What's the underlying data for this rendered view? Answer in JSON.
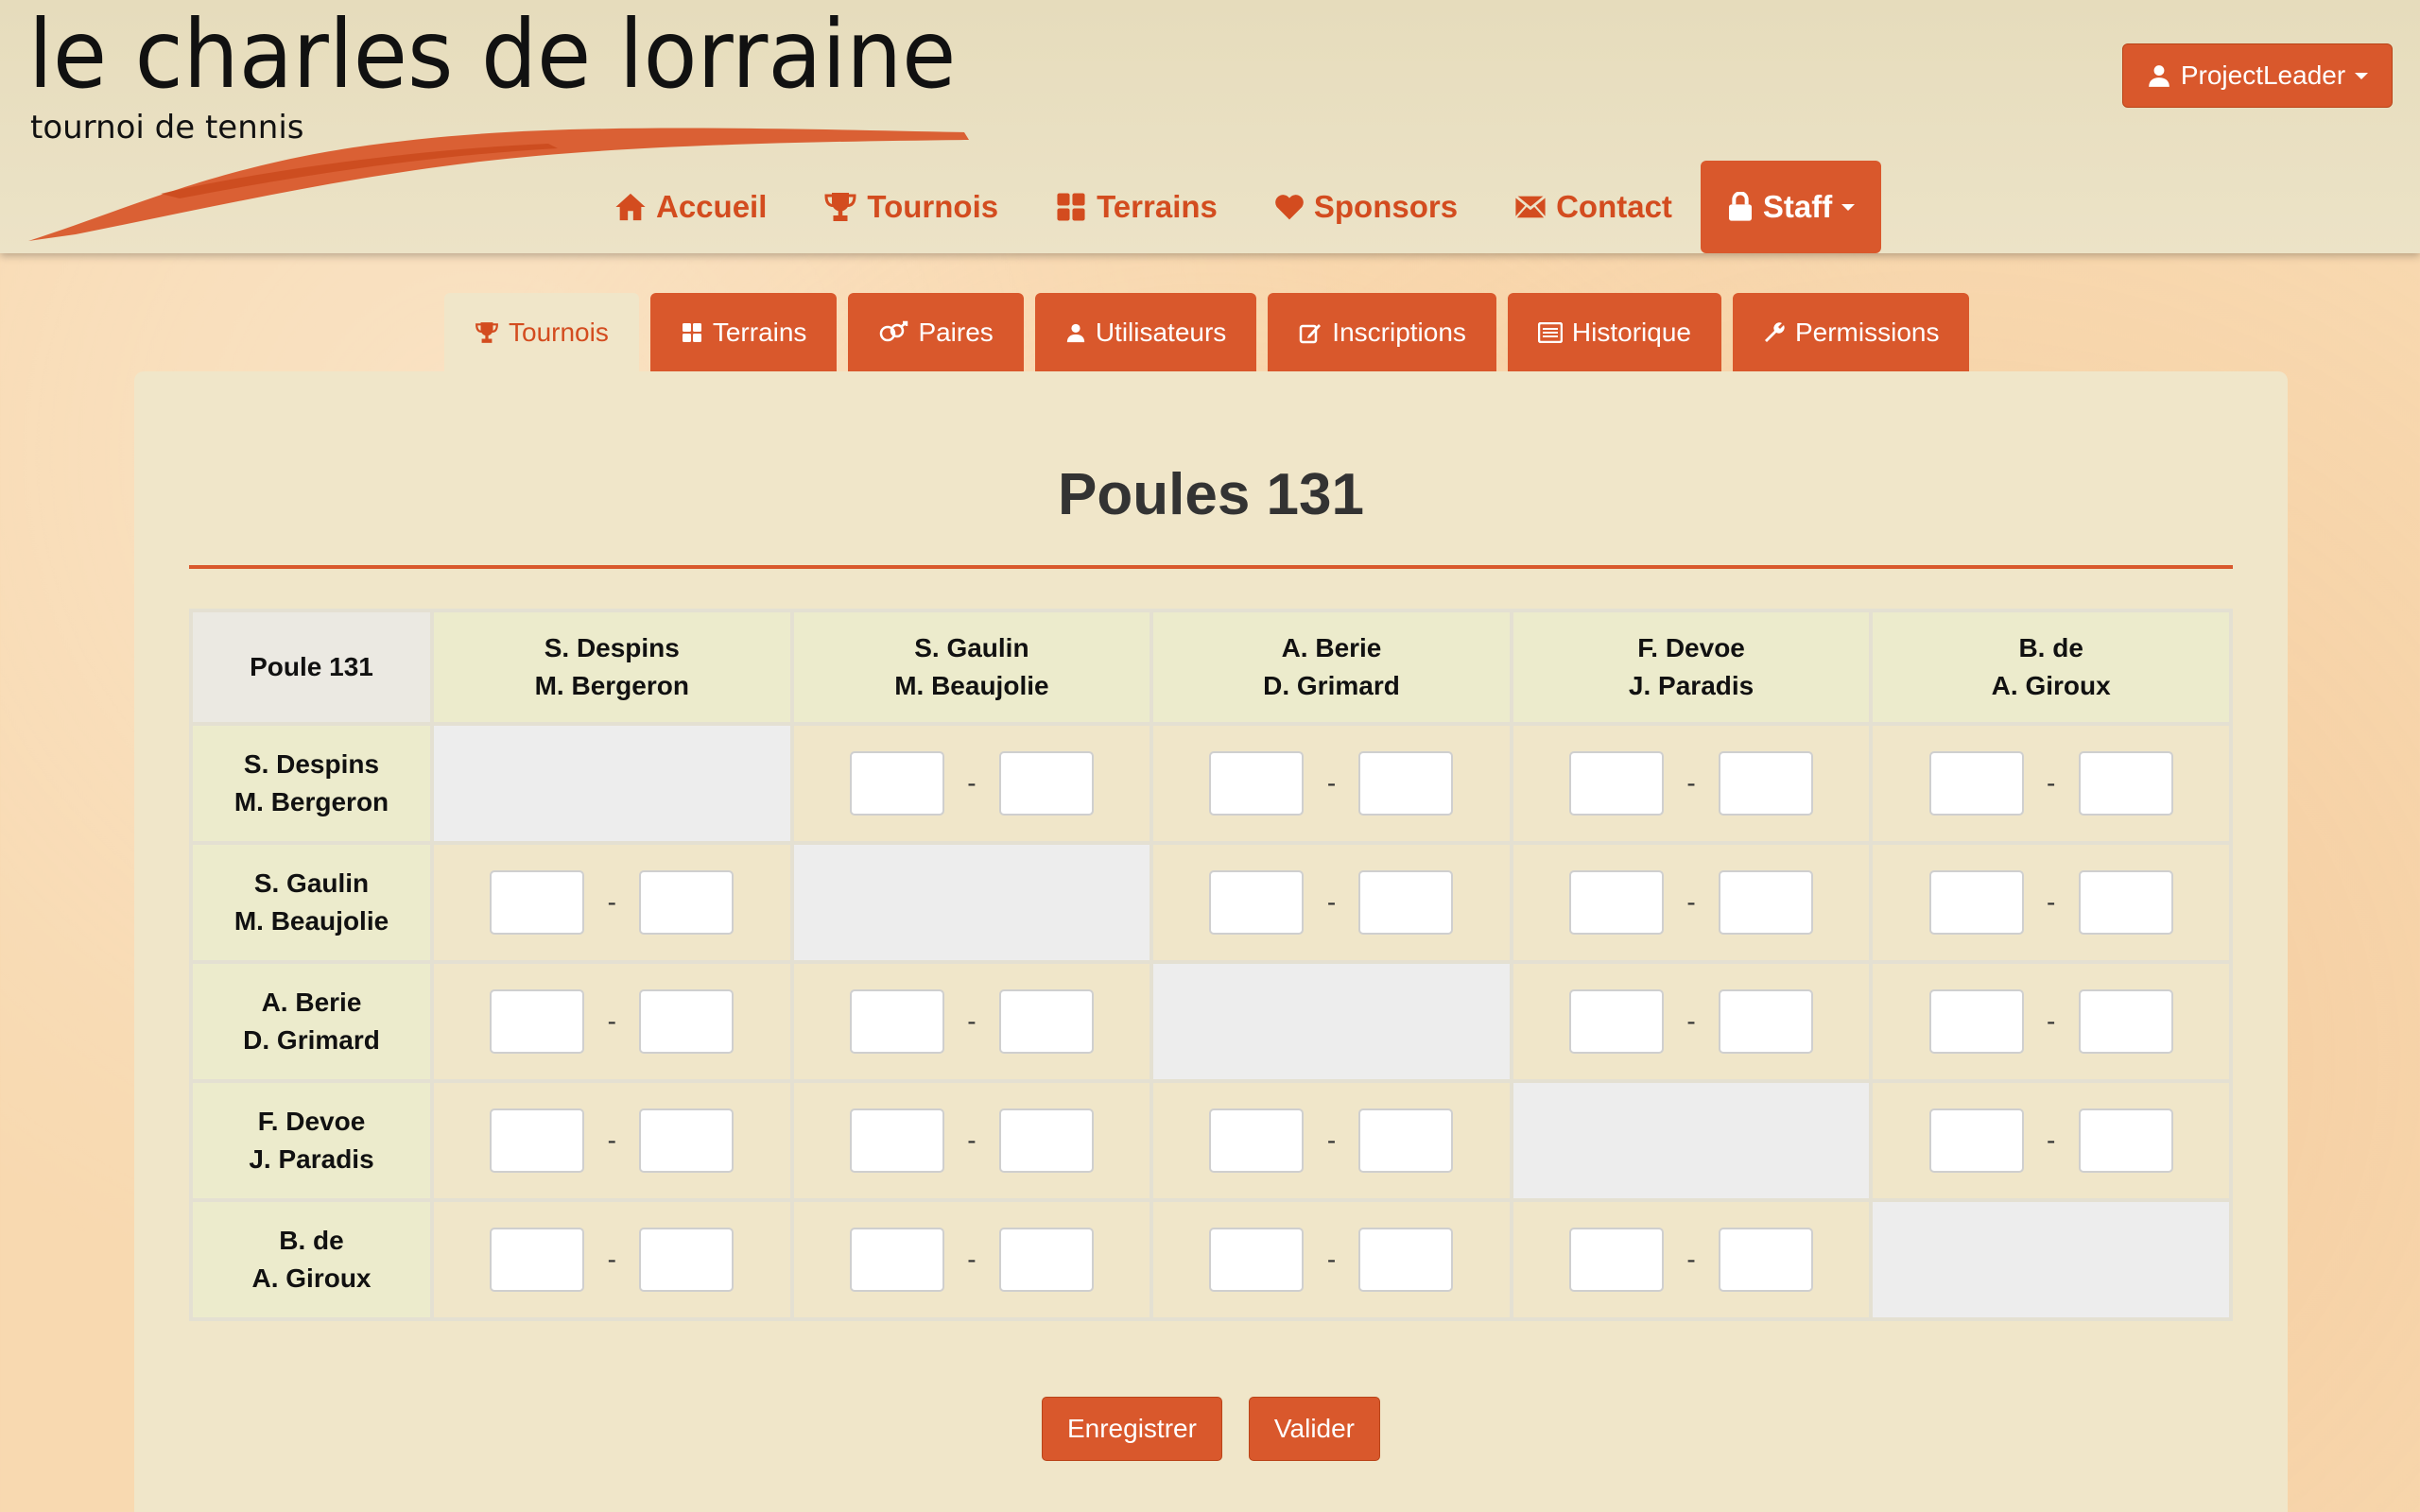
{
  "brand": {
    "title": "le charles de lorraine",
    "subtitle": "tournoi de tennis",
    "accent": "#d9582c"
  },
  "user_menu": {
    "label": "ProjectLeader",
    "icon": "user-icon"
  },
  "nav": [
    {
      "label": "Accueil",
      "icon": "home-icon"
    },
    {
      "label": "Tournois",
      "icon": "trophy-icon"
    },
    {
      "label": "Terrains",
      "icon": "grid-icon"
    },
    {
      "label": "Sponsors",
      "icon": "heart-icon"
    },
    {
      "label": "Contact",
      "icon": "envelope-icon"
    },
    {
      "label": "Staff",
      "icon": "lock-icon",
      "active": true
    }
  ],
  "tabs": [
    {
      "label": "Tournois",
      "icon": "trophy-icon",
      "active": true
    },
    {
      "label": "Terrains",
      "icon": "grid-icon"
    },
    {
      "label": "Paires",
      "icon": "couple-icon"
    },
    {
      "label": "Utilisateurs",
      "icon": "user-icon"
    },
    {
      "label": "Inscriptions",
      "icon": "edit-icon"
    },
    {
      "label": "Historique",
      "icon": "list-icon"
    },
    {
      "label": "Permissions",
      "icon": "wrench-icon"
    }
  ],
  "page": {
    "title": "Poules 131"
  },
  "table": {
    "corner": "Poule 131",
    "pairs": [
      {
        "p1": "S. Despins",
        "p2": "M. Bergeron"
      },
      {
        "p1": "S. Gaulin",
        "p2": "M. Beaujolie"
      },
      {
        "p1": "A. Berie",
        "p2": "D. Grimard"
      },
      {
        "p1": "F. Devoe",
        "p2": "J. Paradis"
      },
      {
        "p1": "B. de",
        "p2": "A. Giroux"
      }
    ],
    "separator": "-"
  },
  "actions": {
    "save": "Enregistrer",
    "validate": "Valider"
  }
}
